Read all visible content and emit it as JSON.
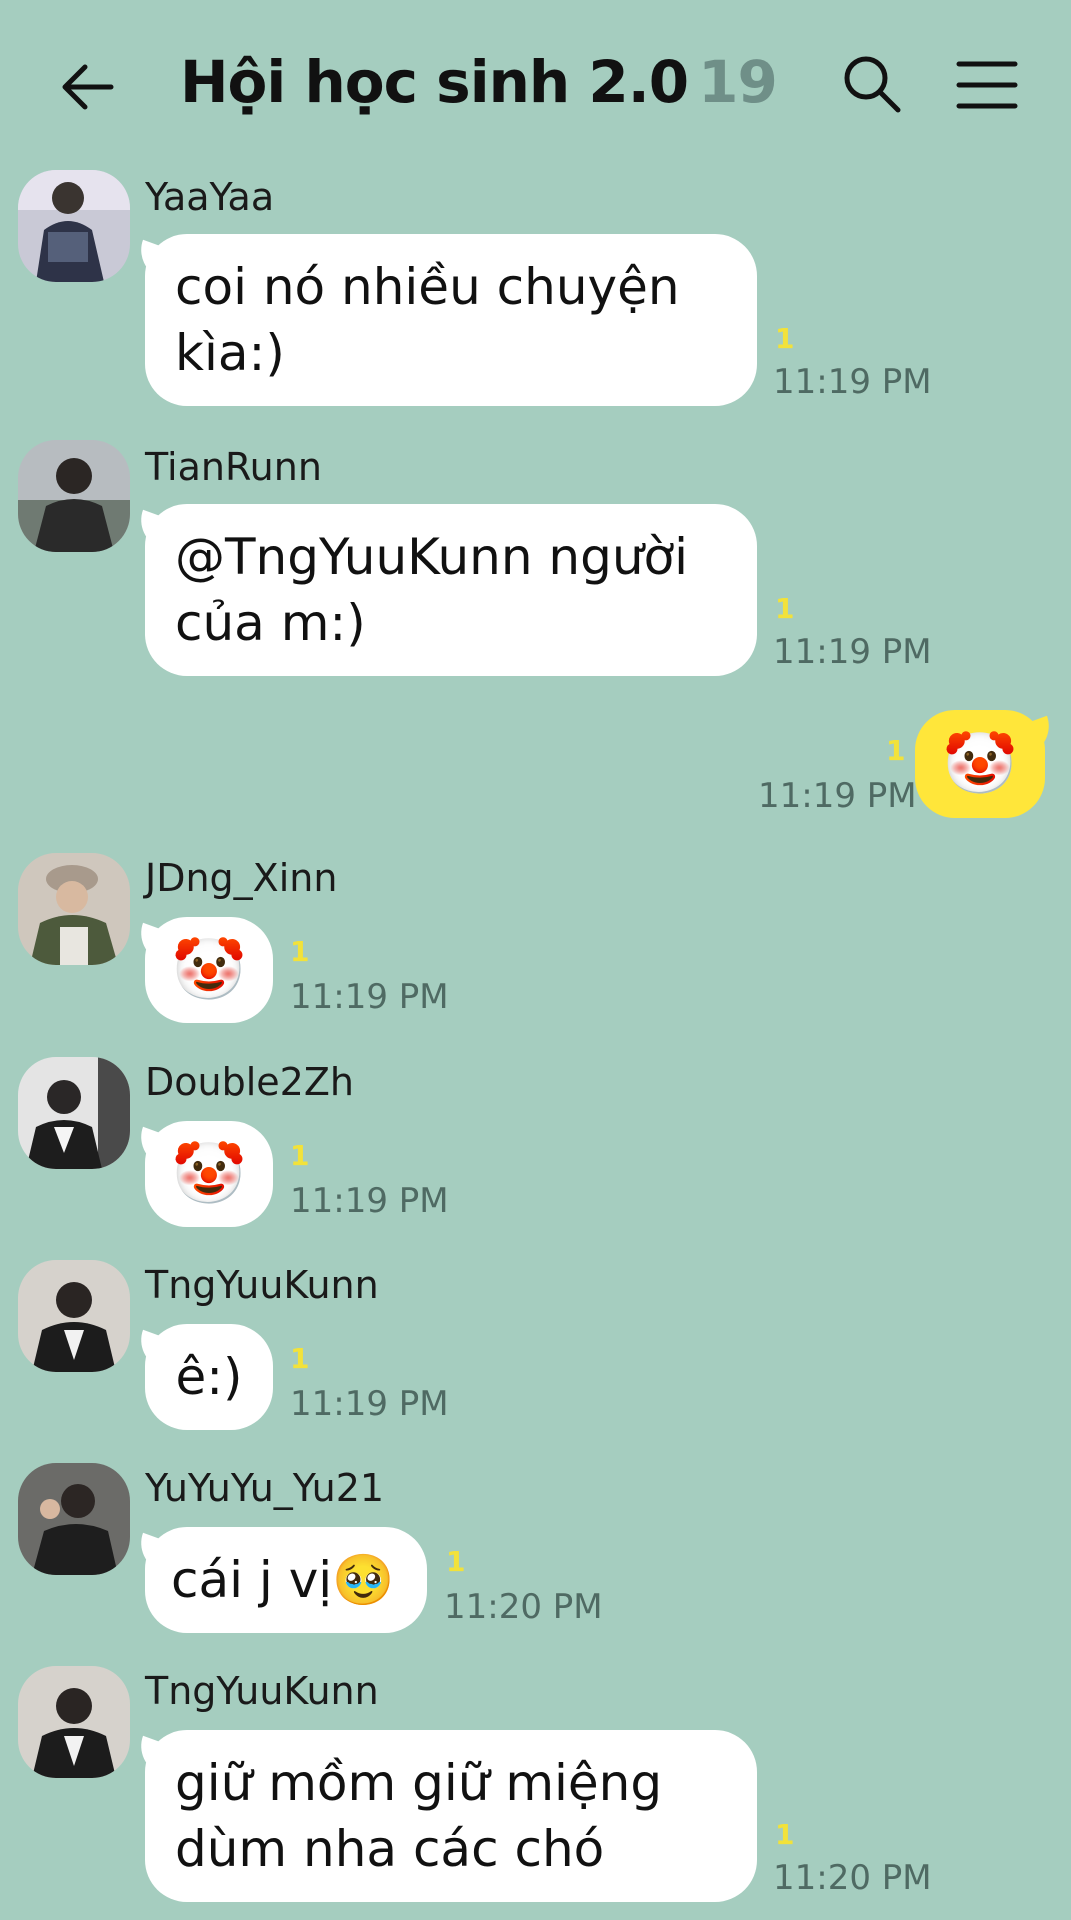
{
  "header": {
    "title": "Hội học sinh 2.0",
    "member_count": "19"
  },
  "messages": [
    {
      "sender": "YaaYaa",
      "text": "coi nó nhiều chuyện kìa:)",
      "unread": "1",
      "time": "11:19 PM"
    },
    {
      "sender": "TianRunn",
      "text": "@TngYuuKunn người của m:)",
      "unread": "1",
      "time": "11:19 PM"
    },
    {
      "sender": "",
      "text": "🤡",
      "unread": "1",
      "time": "11:19 PM",
      "mine": true
    },
    {
      "sender": "JDng_Xinn",
      "text": "🤡",
      "unread": "1",
      "time": "11:19 PM"
    },
    {
      "sender": "Double2Zh",
      "text": "🤡",
      "unread": "1",
      "time": "11:19 PM"
    },
    {
      "sender": "TngYuuKunn",
      "text": "ê:)",
      "unread": "1",
      "time": "11:19 PM"
    },
    {
      "sender": "YuYuYu_Yu21",
      "text": "cái j vị🥹",
      "unread": "1",
      "time": "11:20 PM"
    },
    {
      "sender": "TngYuuKunn",
      "text": "giữ mồm giữ miệng dùm nha các chó",
      "unread": "1",
      "time": "11:20 PM"
    }
  ],
  "colors": {
    "background": "#a5cdbf",
    "bubble_other": "#ffffff",
    "bubble_mine": "#ffe63a",
    "unread": "#f2e23a",
    "timestamp": "#4f6a63"
  },
  "icons": [
    "arrow-left-icon",
    "search-icon",
    "menu-icon",
    "avatar-photo"
  ]
}
